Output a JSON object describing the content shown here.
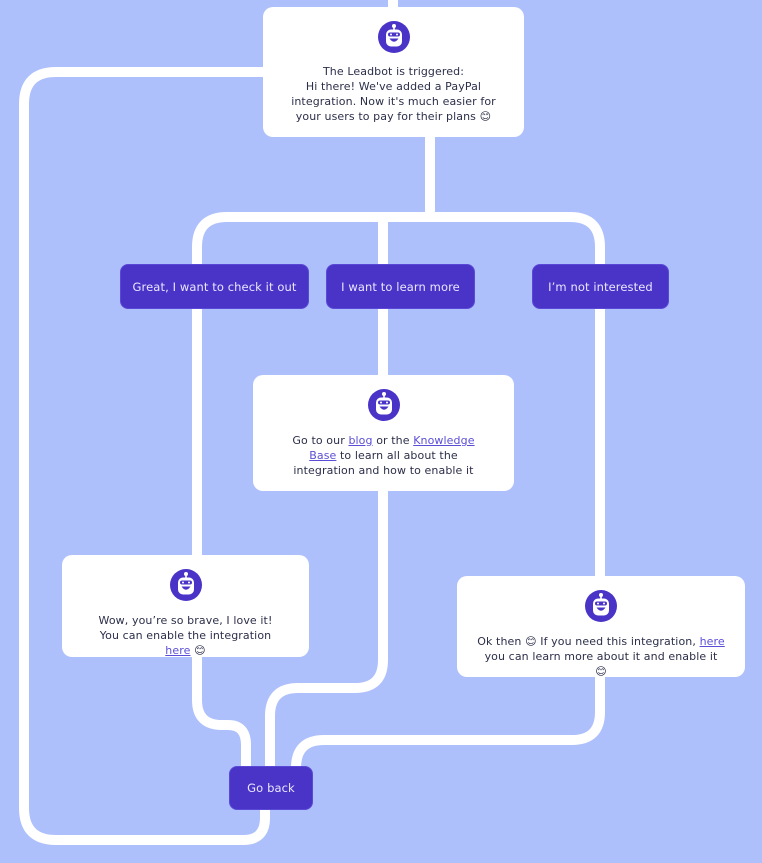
{
  "colors": {
    "background": "#aec0fc",
    "connector": "#ffffff",
    "button": "#4934c7",
    "button_text": "#e9e7ff",
    "card": "#ffffff",
    "text": "#2c2f4a",
    "link": "#5b4ed6"
  },
  "nodes": {
    "trigger": {
      "icon": "robot-icon",
      "title": "The Leadbot is triggered:",
      "message": "Hi there! We've added a PayPal integration. Now it's much easier for your users to pay for their plans",
      "emoji": "😊"
    },
    "options": [
      {
        "label": "Great, I want to check it out"
      },
      {
        "label": "I want to learn more"
      },
      {
        "label": "I’m not interested"
      }
    ],
    "learn_more": {
      "icon": "robot-icon",
      "prefix": "Go to our ",
      "link1": "blog",
      "middle": " or the ",
      "link2": "Knowledge Base",
      "suffix": " to learn all about the integration and how to enable it"
    },
    "check_out": {
      "icon": "robot-icon",
      "prefix": "Wow, you’re so brave, I love it! You can enable the integration ",
      "link": "here",
      "emoji": "😊"
    },
    "not_interested": {
      "icon": "robot-icon",
      "prefix": "Ok then ",
      "emoji1": "😊",
      "middle": " If you need this integration, ",
      "link": "here",
      "suffix": " you can learn more about it and enable it ",
      "emoji2": "😊"
    },
    "go_back": {
      "label": "Go back"
    }
  }
}
